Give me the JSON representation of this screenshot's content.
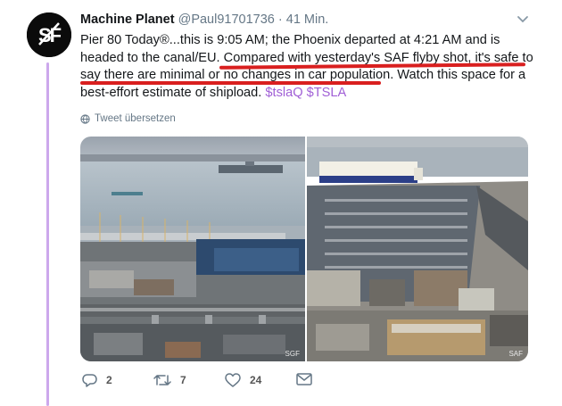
{
  "tweet": {
    "author_name": "Machine Planet",
    "author_handle": "@Paul91701736",
    "separator": "·",
    "time": "41 Min.",
    "text_part1": "Pier 80 Today®...this is 9:05 AM; the Phoenix departed at 4:21 AM and is headed to the canal/EU. ",
    "text_underlined": "Compared with yesterday's SAF flyby shot, it's safe to say there are minimal or no changes in car population",
    "text_part2": ". Watch this space for a best-effort estimate of shipload. ",
    "cashtag1": "$tslaQ",
    "cashtag2": "$TSLA",
    "translate_label": "Tweet übersetzen",
    "photo_left_watermark": "SGF",
    "photo_right_watermark": "SAF",
    "avatar_text": "SF"
  },
  "actions": {
    "reply_count": "2",
    "retweet_count": "7",
    "like_count": "24"
  },
  "colors": {
    "thread_line": "#cca8ec",
    "underline": "#d91f1f",
    "cashtag": "#a05fd6",
    "muted": "#657786"
  }
}
